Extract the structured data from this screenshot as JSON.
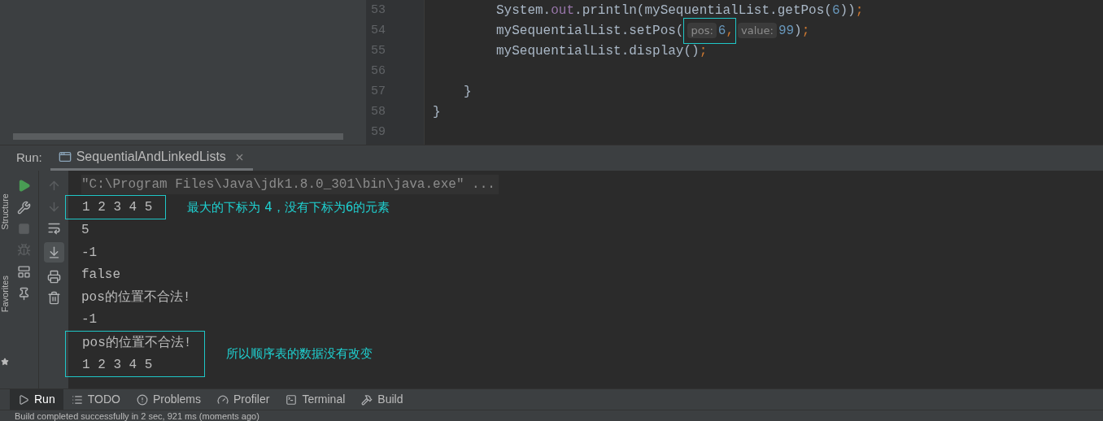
{
  "editor": {
    "lines": [
      {
        "number": "53",
        "segments": [
          {
            "kind": "ident",
            "text": "System."
          },
          {
            "kind": "field",
            "text": "out"
          },
          {
            "kind": "ident",
            "text": ".println(mySequentialList.getPos("
          },
          {
            "kind": "number",
            "text": "6"
          },
          {
            "kind": "ident",
            "text": "))"
          },
          {
            "kind": "punct",
            "text": ";"
          }
        ]
      },
      {
        "number": "54",
        "segments": [
          {
            "kind": "ident",
            "text": "mySequentialList.setPos("
          },
          {
            "kind": "boxed",
            "children": [
              {
                "kind": "hint",
                "text": "pos:"
              },
              {
                "kind": "number",
                "text": "6"
              },
              {
                "kind": "punct",
                "text": ","
              }
            ]
          },
          {
            "kind": "hint",
            "text": "value:"
          },
          {
            "kind": "number",
            "text": "99"
          },
          {
            "kind": "ident",
            "text": ")"
          },
          {
            "kind": "punct",
            "text": ";"
          }
        ]
      },
      {
        "number": "55",
        "segments": [
          {
            "kind": "ident",
            "text": "mySequentialList.display()"
          },
          {
            "kind": "punct",
            "text": ";"
          }
        ]
      },
      {
        "number": "56"
      },
      {
        "number": "57",
        "kind": "method-end",
        "segments": [
          {
            "kind": "ident",
            "text": "}"
          }
        ]
      },
      {
        "number": "58",
        "kind": "class-end",
        "segments": [
          {
            "kind": "ident",
            "text": "}"
          }
        ]
      },
      {
        "number": "59"
      }
    ]
  },
  "run_bar": {
    "label": "Run:",
    "tab": "SequentialAndLinkedLists"
  },
  "console": {
    "scroll_to_end_on": true,
    "command": "\"C:\\Program Files\\Java\\jdk1.8.0_301\\bin\\java.exe\" ...",
    "blocks": [
      {
        "boxed": true,
        "lines": [
          "1 2 3 4 5"
        ],
        "note": "最大的下标为 4，没有下标为6的元素"
      },
      {
        "boxed": false,
        "lines": [
          "5",
          "-1",
          "false",
          "pos的位置不合法!",
          "-1"
        ]
      },
      {
        "boxed": true,
        "lines": [
          "pos的位置不合法!",
          "1 2 3 4 5"
        ],
        "note": "所以顺序表的数据没有改变"
      }
    ]
  },
  "side_labels": [
    "Structure",
    "Favorites"
  ],
  "tool_tabs": [
    {
      "kind": "run",
      "label": "Run",
      "selected": true
    },
    {
      "kind": "todo",
      "label": "TODO",
      "selected": false
    },
    {
      "kind": "problems",
      "label": "Problems",
      "selected": false
    },
    {
      "kind": "profiler",
      "label": "Profiler",
      "selected": false
    },
    {
      "kind": "terminal",
      "label": "Terminal",
      "selected": false
    },
    {
      "kind": "build",
      "label": "Build",
      "selected": false
    }
  ],
  "status_bar": "Build completed successfully in 2 sec, 921 ms (moments ago)"
}
